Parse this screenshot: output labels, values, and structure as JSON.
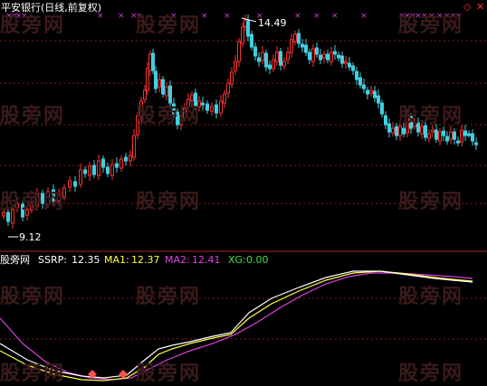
{
  "header": {
    "title": "平安银行(日线,前复权)",
    "title_color": "#ffffff"
  },
  "top_right_icons": [
    "diamond-icon",
    "close-icon"
  ],
  "watermark": "股旁网",
  "price_panel": {
    "high_label": "14.49",
    "low_label": "9.12",
    "up_color": "#ff3030",
    "down_color": "#40d0e0",
    "grid_color": "#8b1a1a",
    "marker_color": "#d040d0"
  },
  "indicator_panel": {
    "name": "股旁网",
    "ssrp_label": "SSRP:",
    "ssrp_value": "12.35",
    "ma1_label": "MA1:",
    "ma1_value": "12.37",
    "ma2_label": "MA2:",
    "ma2_value": "12.41",
    "xg_label": "XG:",
    "xg_value": "0.00",
    "ssrp_color": "#ffffff",
    "ma1_color": "#ffff40",
    "ma2_color": "#e040e0",
    "xg_color": "#40e040"
  },
  "chart_data": {
    "type": "candlestick",
    "title": "平安银行(日线,前复权)",
    "price_range": [
      9.12,
      14.49
    ],
    "indicator": {
      "SSRP": 12.35,
      "MA1": 12.37,
      "MA2": 12.41,
      "XG": 0.0
    }
  }
}
